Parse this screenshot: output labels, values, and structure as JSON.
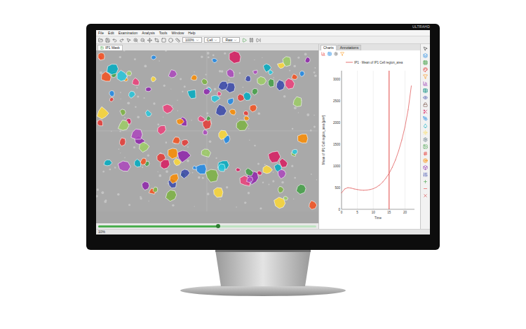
{
  "brand": "ULTRAHD",
  "menu": [
    "File",
    "Edit",
    "Examination",
    "Analysis",
    "Tools",
    "Window",
    "Help"
  ],
  "toolbar": {
    "zoom": "100%",
    "layer": "Cell",
    "mode": "Raw"
  },
  "image_panel": {
    "tab": "IP1 Mask",
    "timeline": {
      "level": 0.55
    }
  },
  "side_tabs": [
    {
      "label": "Charts",
      "selected": true
    },
    {
      "label": "Annotations",
      "selected": false
    }
  ],
  "chart": {
    "legend": "IP1 · Mean of IP1 Cell region_area",
    "y_label": "Mean of IP1 Cell region_area [µm²]",
    "x_label": "Time",
    "y_ticks": [
      "0",
      "500",
      "1000",
      "1500",
      "2000",
      "2500",
      "3000"
    ],
    "x_ticks": [
      "0",
      "5",
      "10",
      "15",
      "20"
    ],
    "marker": 15,
    "series": [
      {
        "name": "IP1",
        "color": "#e57373",
        "values": [
          380,
          470,
          500,
          490,
          470,
          455,
          445,
          440,
          445,
          455,
          475,
          510,
          560,
          630,
          720,
          830,
          970,
          1140,
          1350,
          1600,
          1900,
          2300,
          2850
        ]
      }
    ]
  },
  "status": "10%"
}
